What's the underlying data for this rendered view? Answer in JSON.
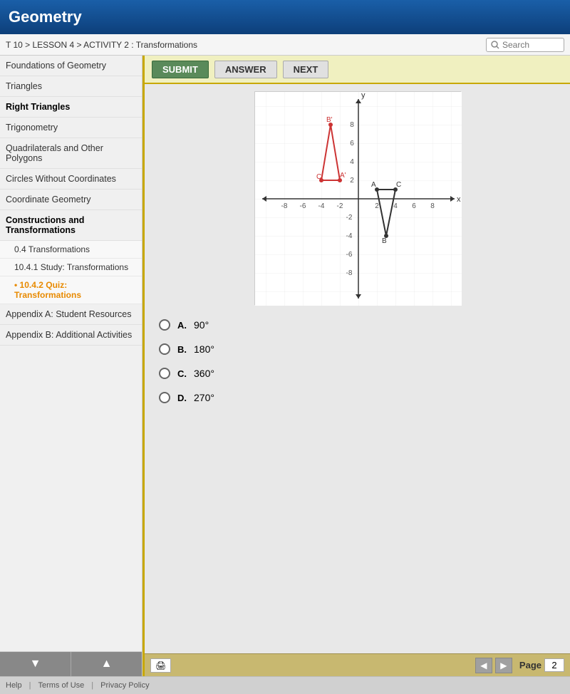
{
  "header": {
    "title": "Geometry"
  },
  "breadcrumb": {
    "text": "T 10 > LESSON 4 > ACTIVITY 2 : Transformations",
    "search_placeholder": "Search"
  },
  "sidebar": {
    "items": [
      {
        "label": "Foundations of Geometry",
        "id": "foundations"
      },
      {
        "label": "Triangles",
        "id": "triangles"
      },
      {
        "label": "Right Triangles",
        "id": "right-triangles"
      },
      {
        "label": "Trigonometry",
        "id": "trigonometry"
      },
      {
        "label": "Quadrilaterals and Other Polygons",
        "id": "quadrilaterals"
      },
      {
        "label": "Circles Without Coordinates",
        "id": "circles"
      },
      {
        "label": "Coordinate Geometry",
        "id": "coordinate"
      },
      {
        "label": "Constructions and Transformations",
        "id": "constructions"
      },
      {
        "label": "0.4 Transformations",
        "id": "unit-transformations"
      },
      {
        "label": "10.4.1 Study: Transformations",
        "id": "study"
      },
      {
        "label": "10.4.2 Quiz: Transformations",
        "id": "quiz"
      },
      {
        "label": "Appendix A: Student Resources",
        "id": "appendix-a"
      },
      {
        "label": "Appendix B: Additional Activities",
        "id": "appendix-b"
      }
    ],
    "nav_down": "▼",
    "nav_up": "▲"
  },
  "toolbar": {
    "submit_label": "SUBMIT",
    "answer_label": "ANSWER",
    "next_label": "NEXT"
  },
  "choices": [
    {
      "letter": "A.",
      "text": "90°"
    },
    {
      "letter": "B.",
      "text": "180°"
    },
    {
      "letter": "C.",
      "text": "360°"
    },
    {
      "letter": "D.",
      "text": "270°"
    }
  ],
  "bottom": {
    "page_label": "Page",
    "page_value": "2"
  },
  "footer": {
    "help": "Help",
    "terms": "Terms of Use",
    "privacy": "Privacy Policy"
  }
}
